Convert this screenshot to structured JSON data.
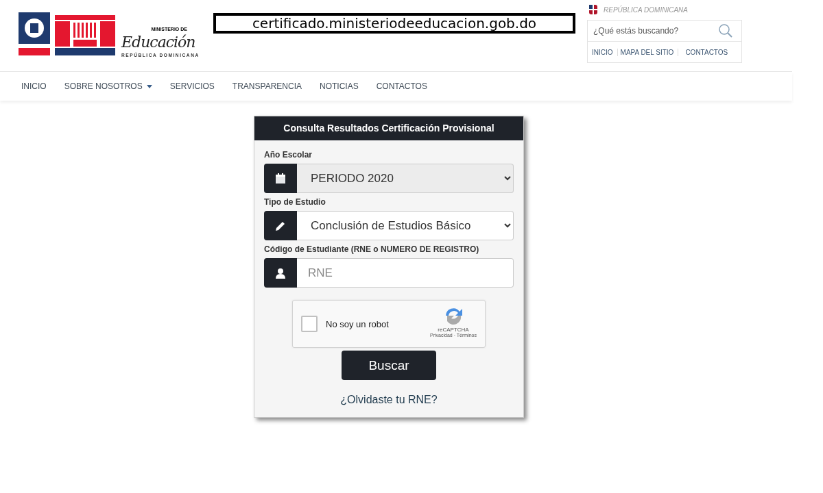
{
  "logo": {
    "top_line": "MINISTERIO DE",
    "main": "Educación",
    "bottom_line": "REPÚBLICA DOMINICANA"
  },
  "url_banner": "certificado.ministeriodeeducacion.gob.do",
  "top_right": {
    "country": "REPÚBLICA DOMINICANA",
    "search": {
      "placeholder": "¿Qué estás buscando?"
    },
    "links": [
      "INICIO",
      "MAPA DEL SITIO",
      "CONTACTOS"
    ]
  },
  "nav": [
    {
      "label": "INICIO",
      "dropdown": false
    },
    {
      "label": "SOBRE NOSOTROS",
      "dropdown": true
    },
    {
      "label": "SERVICIOS",
      "dropdown": false
    },
    {
      "label": "TRANSPARENCIA",
      "dropdown": false
    },
    {
      "label": "NOTICIAS",
      "dropdown": false
    },
    {
      "label": "CONTACTOS",
      "dropdown": false
    }
  ],
  "form": {
    "title": "Consulta Resultados Certificación Provisional",
    "fields": [
      {
        "label": "Año Escolar",
        "kind": "select",
        "value": "PERIODO 2020",
        "disabled": true
      },
      {
        "label": "Tipo de Estudio",
        "kind": "select",
        "value": "Conclusión de Estudios Básico",
        "disabled": false
      },
      {
        "label": "Código de Estudiante (RNE o NUMERO DE REGISTRO)",
        "kind": "input",
        "placeholder": "RNE",
        "disabled": false
      }
    ],
    "captcha": {
      "label": "No soy un robot",
      "checked": false,
      "brand": "reCAPTCHA",
      "privacy": "Privacidad",
      "separator": "·",
      "terms": "Términos"
    },
    "submit": "Buscar",
    "link": "¿Olvidaste tu RNE?"
  }
}
